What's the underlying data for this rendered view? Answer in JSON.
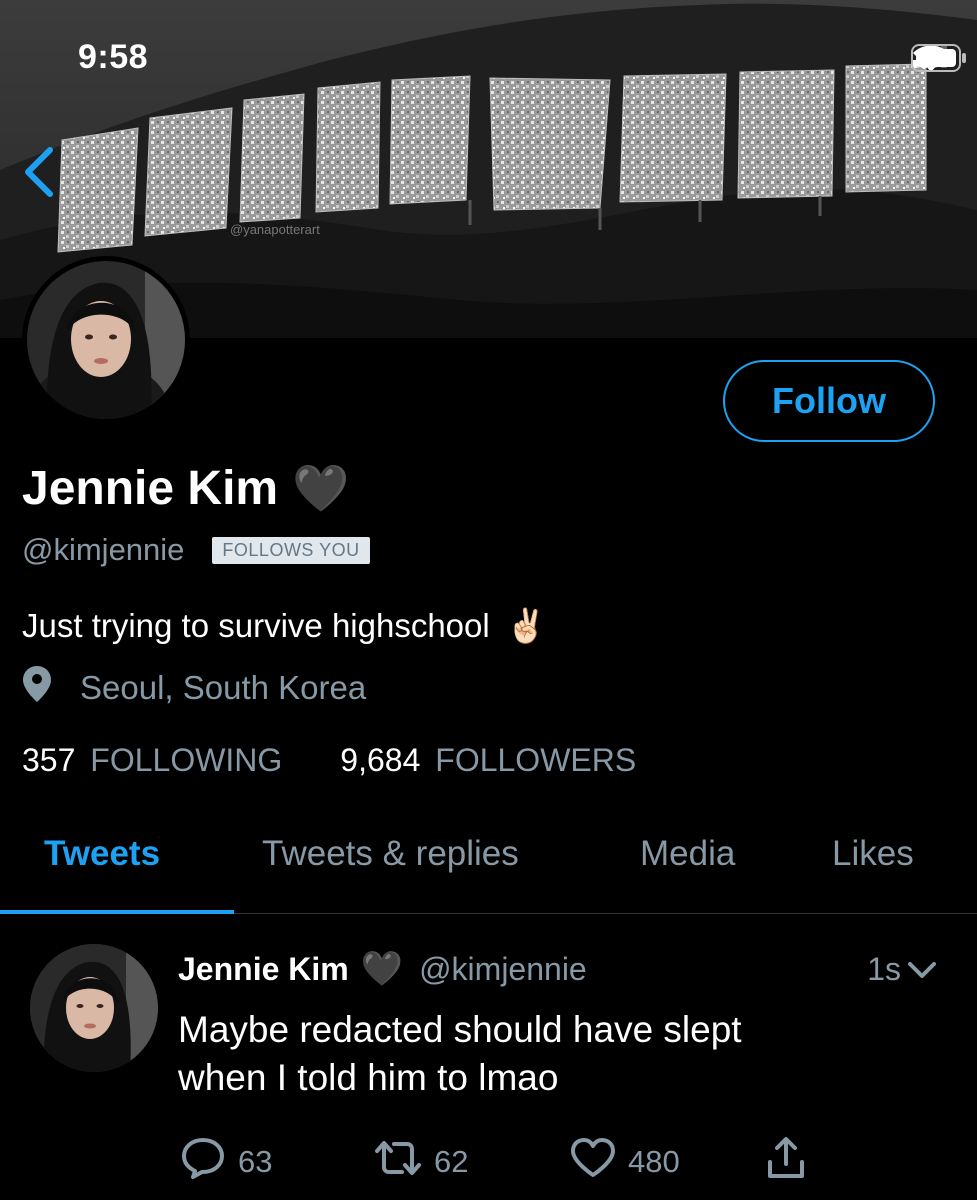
{
  "status_bar": {
    "time": "9:58",
    "icons": [
      "cellular-signal-icon",
      "wifi-icon",
      "battery-icon"
    ]
  },
  "banner": {
    "sign_text": "HOLLYWOOD",
    "watermark": "@yanapotterart"
  },
  "profile": {
    "display_name": "Jennie Kim",
    "name_emoji": "🖤",
    "handle": "@kimjennie",
    "follows_you_badge": "FOLLOWS YOU",
    "bio": "Just trying to survive highschool",
    "bio_emoji": "✌🏻",
    "location": "Seoul, South Korea",
    "follow_button": "Follow",
    "stats": {
      "following_count": "357",
      "following_label": "FOLLOWING",
      "followers_count": "9,684",
      "followers_label": "FOLLOWERS"
    }
  },
  "tabs": [
    {
      "label": "Tweets",
      "active": true
    },
    {
      "label": "Tweets & replies",
      "active": false
    },
    {
      "label": "Media",
      "active": false
    },
    {
      "label": "Likes",
      "active": false
    }
  ],
  "tweet": {
    "name": "Jennie Kim",
    "name_emoji": "🖤",
    "handle": "@kimjennie",
    "time": "1s",
    "text_lines": [
      "Maybe redacted should have slept",
      "when I told him to lmao"
    ],
    "replies": "63",
    "retweets": "62",
    "likes": "480"
  },
  "colors": {
    "accent": "#1da1f2",
    "secondary_text": "#8899a6",
    "background": "#000000"
  }
}
